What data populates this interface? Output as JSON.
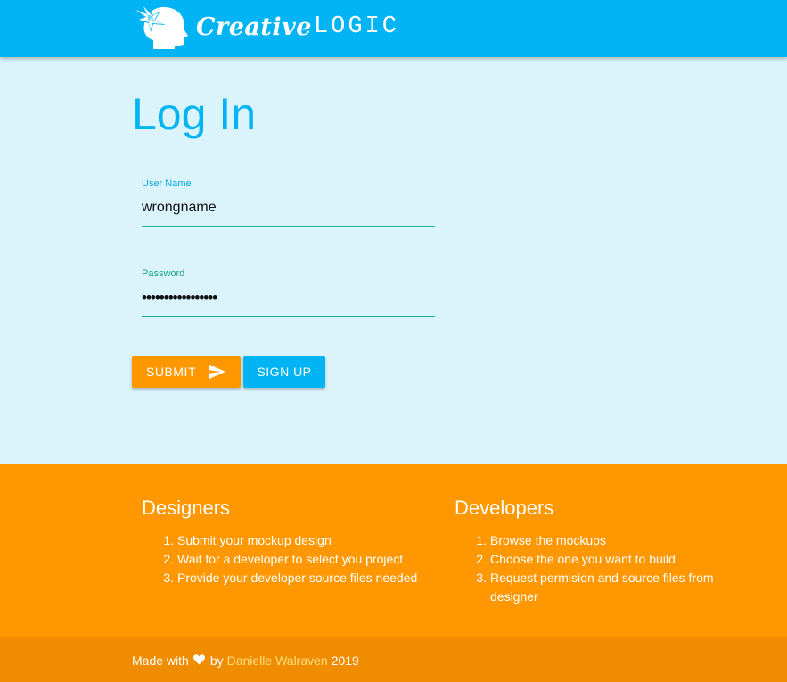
{
  "header": {
    "logo_creative": "Creative",
    "logo_logic": "LOGIC",
    "logo_icon": "head-origami-bird-icon"
  },
  "login": {
    "title": "Log In",
    "username": {
      "label": "User Name",
      "value": "wrongname"
    },
    "password": {
      "label": "Password",
      "value": "•••••••••••••••••"
    },
    "submit_label": "SUBMIT",
    "submit_icon": "send-icon",
    "signup_label": "SIGN UP"
  },
  "footer": {
    "designers": {
      "title": "Designers",
      "items": [
        "Submit your mockup design",
        "Wait for a developer to select you project",
        "Provide your developer source files needed"
      ]
    },
    "developers": {
      "title": "Developers",
      "items": [
        "Browse the mockups",
        "Choose the one you want to build",
        "Request permision and source files from designer"
      ]
    }
  },
  "bottombar": {
    "made_with": "Made with",
    "heart_icon": "heart-icon",
    "by": "by",
    "author": "Danielle Walraven",
    "year": "2019"
  },
  "colors": {
    "primary": "#03b4f5",
    "accent": "#ff9800",
    "background": "#dbf4fc",
    "bottombar": "#ef8c00"
  }
}
